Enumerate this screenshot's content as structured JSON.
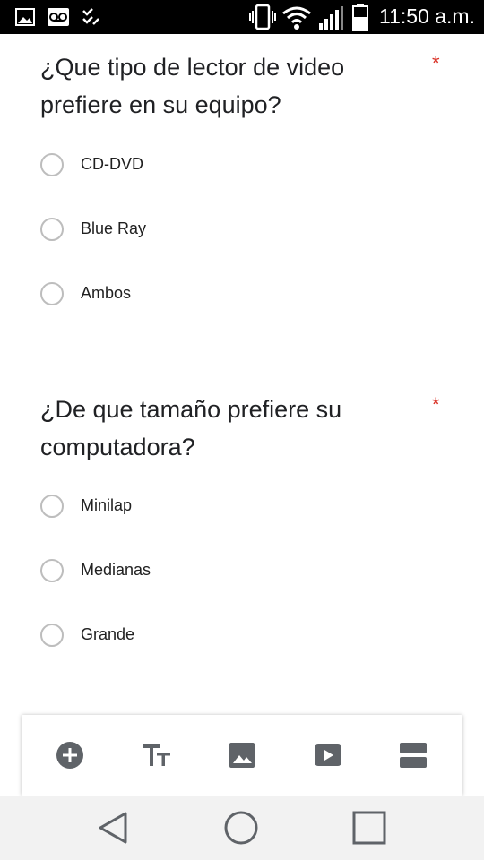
{
  "status_bar": {
    "time": "11:50 a.m.",
    "icons": [
      "image-icon",
      "voicemail-icon",
      "checklist-icon",
      "vibrate-icon",
      "wifi-icon",
      "signal-icon",
      "battery-icon"
    ]
  },
  "questions": [
    {
      "title": "¿Que tipo de lector de video prefiere en su equipo?",
      "required_mark": "*",
      "options": [
        "CD-DVD",
        "Blue Ray",
        "Ambos"
      ]
    },
    {
      "title": "¿De que tamaño prefiere su computadora?",
      "required_mark": "*",
      "options": [
        "Minilap",
        "Medianas",
        "Grande"
      ]
    }
  ],
  "toolbar": {
    "icons": [
      "add-question-icon",
      "title-text-icon",
      "image-icon",
      "video-icon",
      "section-icon"
    ],
    "icon_color": "#5f6368"
  },
  "nav_bar": {
    "icons": [
      "back-icon",
      "home-icon",
      "recents-icon"
    ]
  },
  "colors": {
    "required": "#d93025",
    "radio_border": "#bdbdbd",
    "text": "#202124"
  }
}
